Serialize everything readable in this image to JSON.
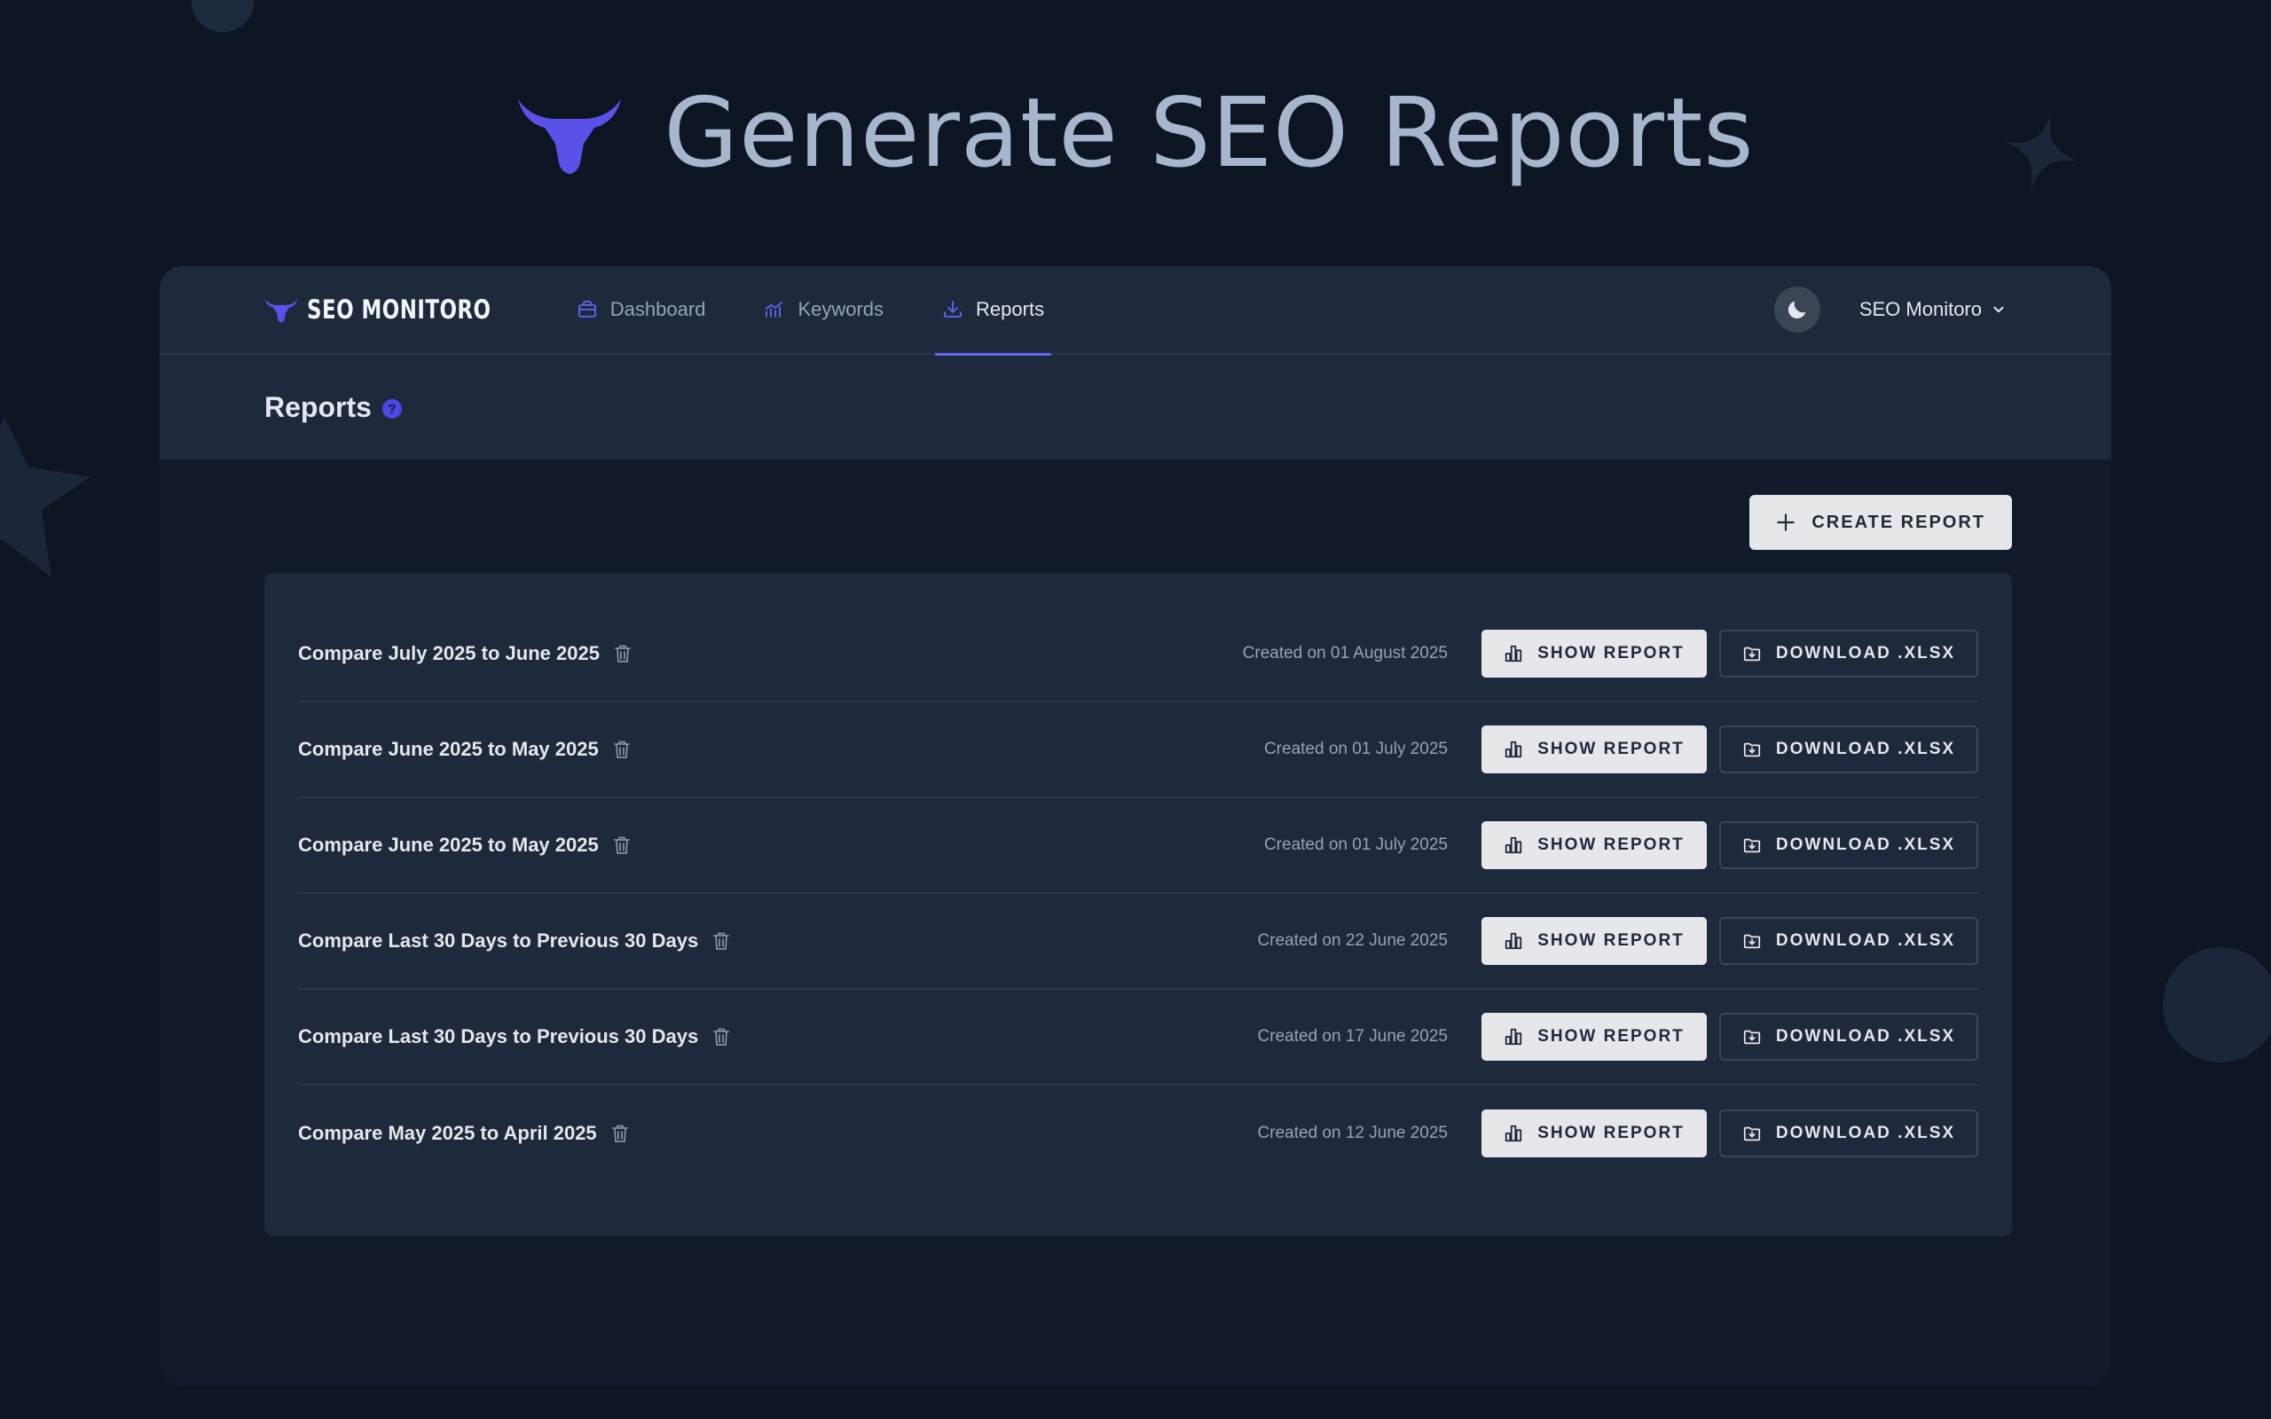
{
  "hero": {
    "title": "Generate SEO Reports"
  },
  "brand": {
    "name": "SEO MONITORO"
  },
  "nav": {
    "items": [
      {
        "label": "Dashboard",
        "icon": "briefcase-icon"
      },
      {
        "label": "Keywords",
        "icon": "chart-icon"
      },
      {
        "label": "Reports",
        "icon": "download-tray-icon",
        "active": true
      }
    ],
    "account": "SEO Monitoro"
  },
  "page": {
    "title": "Reports",
    "help": "?"
  },
  "toolbar": {
    "create_label": "CREATE REPORT"
  },
  "reports": [
    {
      "title": "Compare July 2025 to June 2025",
      "created": "Created on 01 August 2025"
    },
    {
      "title": "Compare June 2025 to May 2025",
      "created": "Created on 01 July 2025"
    },
    {
      "title": "Compare June 2025 to May 2025",
      "created": "Created on 01 July 2025"
    },
    {
      "title": "Compare Last 30 Days to Previous 30 Days",
      "created": "Created on 22 June 2025"
    },
    {
      "title": "Compare Last 30 Days to Previous 30 Days",
      "created": "Created on 17 June 2025"
    },
    {
      "title": "Compare May 2025 to April 2025",
      "created": "Created on 12 June 2025"
    }
  ],
  "row_actions": {
    "show_label": "SHOW REPORT",
    "download_label": "DOWNLOAD .XLSX"
  },
  "colors": {
    "accent": "#6366f1",
    "background": "#0d1523",
    "surface": "#1e293b"
  }
}
